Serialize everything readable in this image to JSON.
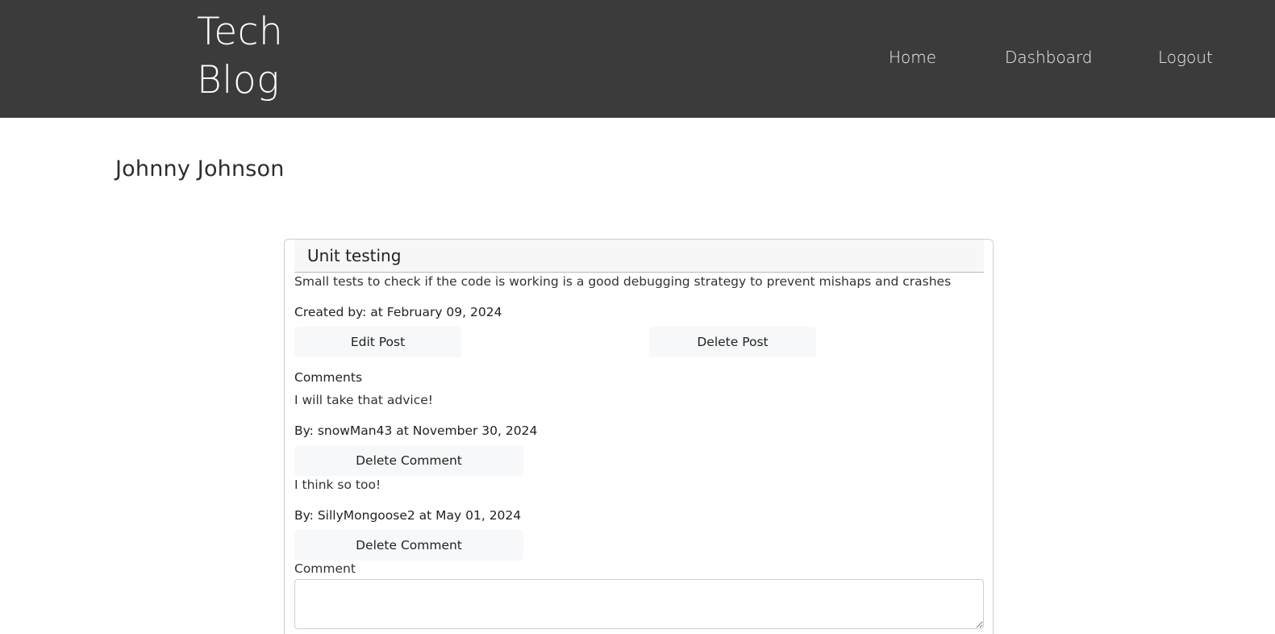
{
  "nav": {
    "brand_line1": "Tech",
    "brand_line2": "Blog",
    "links": [
      {
        "label": "Home"
      },
      {
        "label": "Dashboard"
      },
      {
        "label": "Logout"
      }
    ]
  },
  "user": {
    "name": "Johnny Johnson"
  },
  "post": {
    "title": "Unit testing",
    "body": "Small tests to check if the code is working is a good debugging strategy to prevent mishaps and crashes",
    "meta": "Created by: at February 09, 2024",
    "edit_label": "Edit Post",
    "delete_label": "Delete Post",
    "comments_heading": "Comments",
    "comments": [
      {
        "text": "I will take that advice!",
        "meta": "By: snowMan43 at November 30, 2024",
        "delete_label": "Delete Comment"
      },
      {
        "text": "I think so too!",
        "meta": "By: SillyMongoose2 at May 01, 2024",
        "delete_label": "Delete Comment"
      }
    ],
    "comment_field_label": "Comment",
    "comment_field_value": ""
  }
}
